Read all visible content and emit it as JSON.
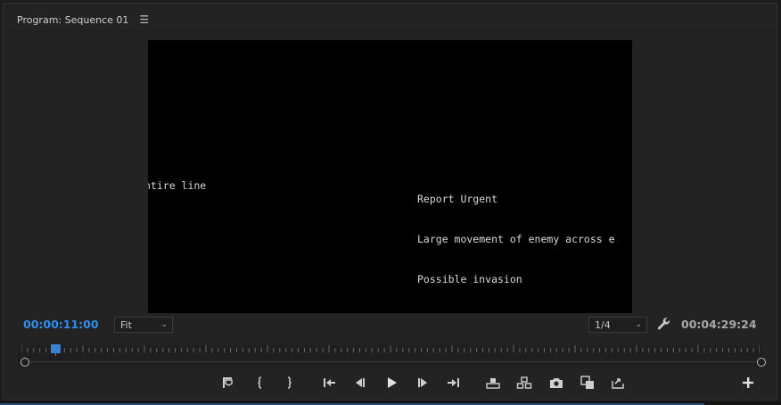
{
  "panel": {
    "title": "Program: Sequence 01",
    "menu_icon": "hamburger-menu-icon"
  },
  "video": {
    "caption_left": "ntire line",
    "caption_right_lines": [
      "Report Urgent",
      "Large movement of enemy across e",
      "Possible invasion"
    ]
  },
  "controls": {
    "current_timecode": "00:00:11:00",
    "duration_timecode": "00:04:29:24",
    "zoom_value": "Fit",
    "resolution_value": "1/4",
    "settings_icon": "wrench-icon"
  },
  "timeline": {
    "playhead_fraction": 0.041
  },
  "transport_icons": [
    "add-marker-icon",
    "mark-in-icon",
    "mark-out-icon",
    "go-to-in-icon",
    "step-back-icon",
    "play-icon",
    "step-forward-icon",
    "go-to-out-icon",
    "lift-icon",
    "extract-icon",
    "export-frame-icon",
    "comparison-view-icon",
    "vr-video-icon",
    "button-editor-plus-icon"
  ],
  "colors": {
    "accent": "#2f8ef0",
    "panel_bg": "#232323",
    "video_bg": "#000000"
  }
}
